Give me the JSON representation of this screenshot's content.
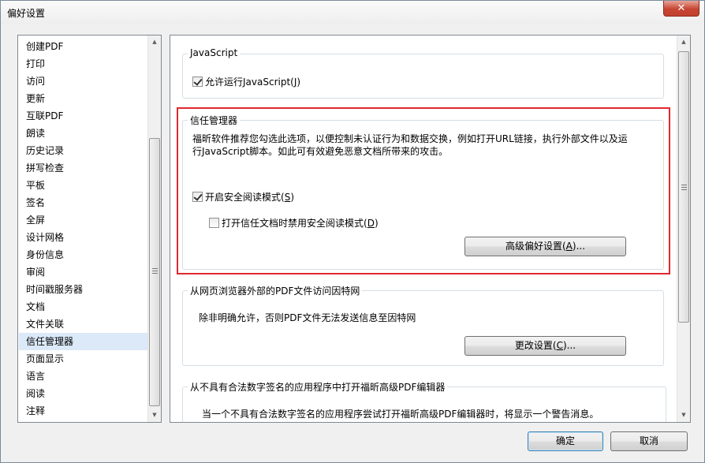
{
  "window": {
    "title": "偏好设置",
    "close_label": "✕"
  },
  "sidebar": {
    "items": [
      {
        "label": "创建PDF"
      },
      {
        "label": "打印"
      },
      {
        "label": "访问"
      },
      {
        "label": "更新"
      },
      {
        "label": "互联PDF"
      },
      {
        "label": "朗读"
      },
      {
        "label": "历史记录"
      },
      {
        "label": "拼写检查"
      },
      {
        "label": "平板"
      },
      {
        "label": "签名"
      },
      {
        "label": "全屏"
      },
      {
        "label": "设计网格"
      },
      {
        "label": "身份信息"
      },
      {
        "label": "审阅"
      },
      {
        "label": "时间戳服务器"
      },
      {
        "label": "文档"
      },
      {
        "label": "文件关联"
      },
      {
        "label": "信任管理器",
        "selected": true
      },
      {
        "label": "页面显示"
      },
      {
        "label": "语言"
      },
      {
        "label": "阅读"
      },
      {
        "label": "注释"
      }
    ]
  },
  "javascript": {
    "title": "JavaScript",
    "allow": {
      "label": "允许运行JavaScript(",
      "key": "J",
      "suffix": ")",
      "checked": true
    }
  },
  "trust": {
    "title": "信任管理器",
    "description_line1": "福昕软件推荐您勾选此选项，以便控制未认证行为和数据交换，例如打开URL链接，执行外部文件以及运",
    "description_line2": "行JavaScript脚本。如此可有效避免恶意文档所带来的攻击。",
    "safe_mode": {
      "label": "开启安全阅读模式(",
      "key": "S",
      "suffix": ")",
      "checked": true
    },
    "disable_trusted": {
      "label": "打开信任文档时禁用安全阅读模式(",
      "key": "D",
      "suffix": ")",
      "checked": false
    },
    "advanced_button": {
      "label": "高级偏好设置(",
      "key": "A",
      "suffix": ")..."
    }
  },
  "internet": {
    "title": "从网页浏览器外部的PDF文件访问因特网",
    "description": "除非明确允许，否则PDF文件无法发送信息至因特网",
    "change_button": {
      "label": "更改设置(",
      "key": "C",
      "suffix": ")..."
    }
  },
  "unsigned": {
    "title": "从不具有合法数字签名的应用程序中打开福昕高级PDF编辑器",
    "description": "当一个不具有合法数字签名的应用程序尝试打开福昕高级PDF编辑器时，将显示一个警告消息。"
  },
  "footer": {
    "ok_label": "确定",
    "cancel_label": "取消"
  }
}
